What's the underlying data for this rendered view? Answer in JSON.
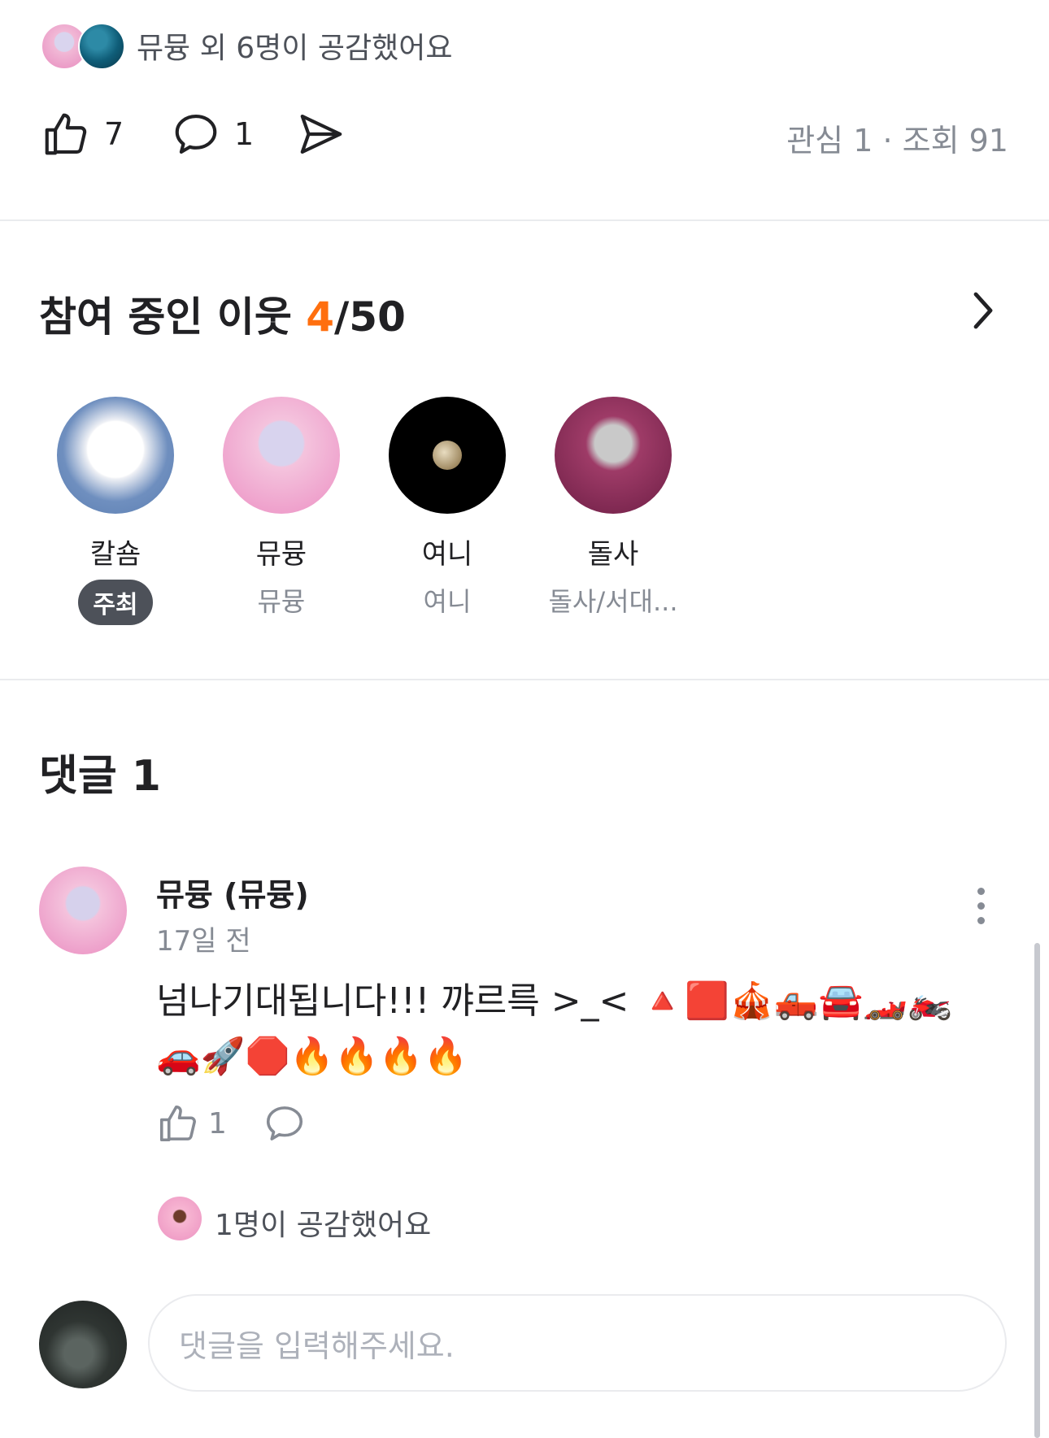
{
  "post": {
    "reactions_text": "뮤뮹 외 6명이 공감했어요",
    "like_count": "7",
    "comment_count": "1",
    "stats": "관심 1 · 조회 91"
  },
  "participants": {
    "title_prefix": "참여 중인 이웃 ",
    "current": "4",
    "total": "/50",
    "members": [
      {
        "name": "칼숌",
        "badge": "주최"
      },
      {
        "name": "뮤뮹",
        "sub": "뮤뮹"
      },
      {
        "name": "여니",
        "sub": "여니"
      },
      {
        "name": "돌사",
        "sub": "돌사/서대..."
      }
    ]
  },
  "comments": {
    "title": "댓글 1",
    "items": [
      {
        "author": "뮤뮹 (뮤뮹)",
        "time": "17일 전",
        "text": "넘나기대됩니다!!! 꺄르륵 >_< 🔺🟥🎪🛻🚘🏎️🏍️🚗🚀🛑🔥🔥🔥🔥",
        "like_count": "1",
        "likes_text": "1명이 공감했어요"
      }
    ],
    "input_placeholder": "댓글을 입력해주세요."
  },
  "colors": {
    "accent": "#ff6f0f",
    "text": "#212124",
    "muted": "#868b94",
    "divider": "#eaebee"
  }
}
